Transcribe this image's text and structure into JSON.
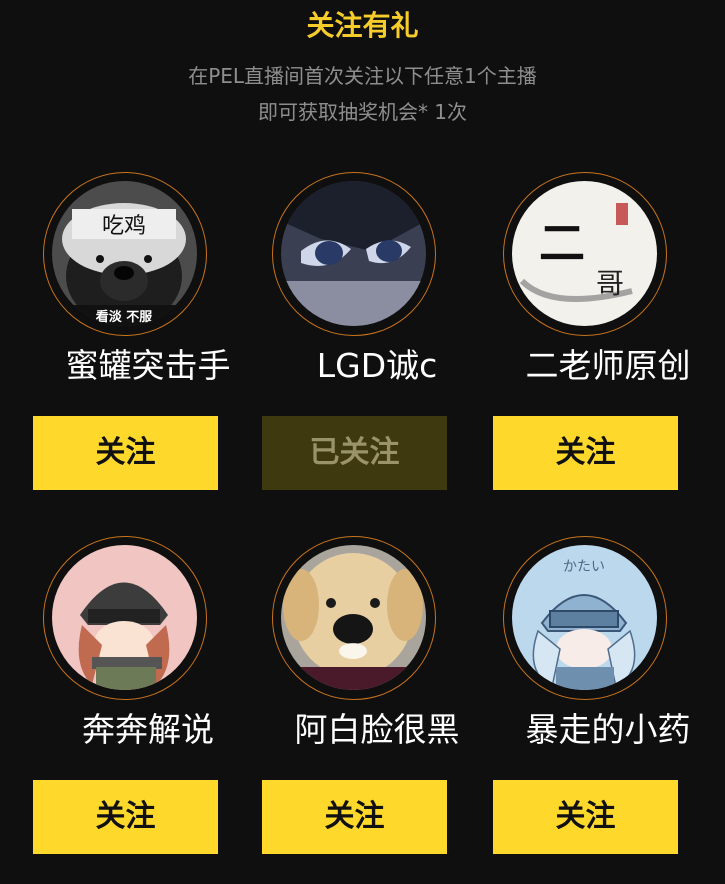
{
  "header": {
    "title": "关注有礼",
    "subtitle_line1": "在PEL直播间首次关注以下任意1个主播",
    "subtitle_line2": "即可获取抽奖机会* 1次"
  },
  "streamers": [
    {
      "name": "蜜罐突击手",
      "button_label": "关注",
      "followed": false,
      "avatar_text": "吃鸡",
      "avatar_caption": "看淡 不服"
    },
    {
      "name": "LGD诚c",
      "button_label": "已关注",
      "followed": true
    },
    {
      "name": "二老师原创",
      "button_label": "关注",
      "followed": false,
      "avatar_text_main": "二",
      "avatar_text_sub": "哥"
    },
    {
      "name": "奔奔解说",
      "button_label": "关注",
      "followed": false
    },
    {
      "name": "阿白脸很黑",
      "button_label": "关注",
      "followed": false
    },
    {
      "name": "暴走的小药",
      "button_label": "关注",
      "followed": false,
      "avatar_text": "かたい"
    }
  ],
  "colors": {
    "background": "#0f0f0f",
    "accent": "#f5cc2a",
    "button": "#fed82b",
    "button_followed": "#3f3910",
    "ring": "#c8741d"
  }
}
